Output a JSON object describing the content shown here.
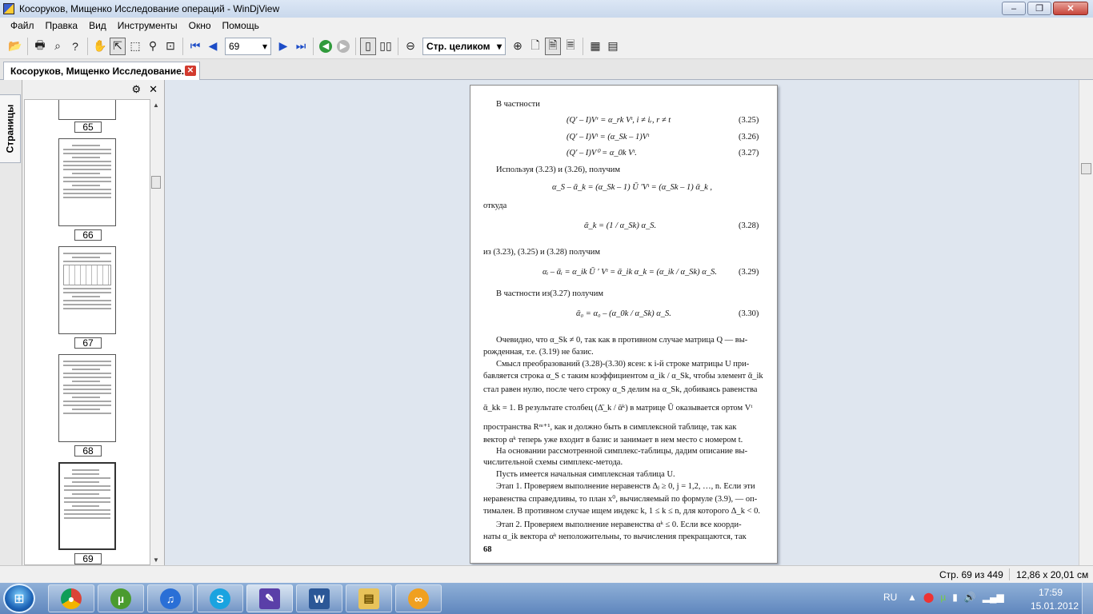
{
  "window": {
    "title": "Косоруков, Мищенко Исследование операций - WinDjView",
    "controls": {
      "minimize": "‒",
      "maximize": "❐",
      "close": "✕"
    }
  },
  "menu": [
    "Файл",
    "Правка",
    "Вид",
    "Инструменты",
    "Окно",
    "Помощь"
  ],
  "toolbar": {
    "page_number": "69",
    "zoom_mode": "Стр. целиком"
  },
  "tab": {
    "label": "Косоруков, Мищенко Исследование...",
    "close": "✕"
  },
  "sidebar": {
    "tab_label": "Страницы",
    "thumbnails": [
      {
        "page": "65"
      },
      {
        "page": "66"
      },
      {
        "page": "67"
      },
      {
        "page": "68"
      },
      {
        "page": "69"
      }
    ]
  },
  "document": {
    "lines": [
      {
        "text": "В частности",
        "style": "text"
      },
      {
        "text": "(Q′ – I)Vʳ = α_rk Vᵗ, i ≠ iᵣ, r ≠ t",
        "num": "(3.25)",
        "style": "eq"
      },
      {
        "text": "(Q′ – I)Vᵗ = (α_Sk – 1)Vᵗ",
        "num": "(3.26)",
        "style": "eq"
      },
      {
        "text": "(Q′ – I)V⁰ = α_0k Vᵗ.",
        "num": "(3.27)",
        "style": "eq"
      },
      {
        "text": "Используя (3.23) и (3.26), получим",
        "style": "text"
      },
      {
        "text": "α_S – ᾱ_k = (α_Sk – 1) Ū ′Vᵗ = (α_Sk – 1) ᾱ_k ,",
        "style": "eq"
      },
      {
        "text": "откуда",
        "style": "text"
      },
      {
        "text": "ᾱ_k = (1 / α_Sk) α_S.",
        "num": "(3.28)",
        "style": "eq"
      },
      {
        "text": "из (3.23), (3.25) и (3.28) получим",
        "style": "text"
      },
      {
        "text": "αᵢ – ᾱᵢ = α_ik Ū ′ Vᵗ = ᾱ_ik α_k = (α_ik / α_Sk) α_S.",
        "num": "(3.29)",
        "style": "eq"
      },
      {
        "text": "В частности из(3.27) получим",
        "style": "text"
      },
      {
        "text": "ᾱ₀ = α₀ – (α_0k / α_Sk) α_S.",
        "num": "(3.30)",
        "style": "eq"
      },
      {
        "text": "Очевидно, что α_Sk ≠ 0, так как в противном случае матрица Q — вы-",
        "style": "para"
      },
      {
        "text": "рожденная, т.е. (3.19) не базис.",
        "style": "text0"
      },
      {
        "text": "Смысл преобразований (3.28)-(3.30) ясен: к i-й строке матрицы U при-",
        "style": "para"
      },
      {
        "text": "бавляется строка α_S с таким коэффициентом α_ik / α_Sk, чтобы элемент ᾱ_ik",
        "style": "text0"
      },
      {
        "text": "стал равен нулю, после чего строку α_S делим на α_Sk, добиваясь равенства",
        "style": "text0"
      },
      {
        "text": "ᾱ_kk = 1. В результате столбец (Δ̄_k / ᾱᵏ) в матрице Ū оказывается ортом Vᵗ",
        "style": "text0"
      },
      {
        "text": "пространства Rᵐ⁺¹, как и должно быть в симплексной таблице, так как",
        "style": "text0"
      },
      {
        "text": "вектор αᵏ теперь уже входит в базис и занимает в нем место с номером t.",
        "style": "text0"
      },
      {
        "text": "На основании рассмотренной симплекс-таблицы, дадим описание вы-",
        "style": "para"
      },
      {
        "text": "числительной схемы симплекс-метода.",
        "style": "text0"
      },
      {
        "text": "Пусть имеется начальная симплексная таблица U.",
        "style": "para"
      },
      {
        "text": "Этап 1. Проверяем выполнение неравенств Δⱼ ≥ 0, j = 1,2, …, n. Если эти",
        "style": "para"
      },
      {
        "text": "неравенства справедливы, то план x⁰, вычисляемый по формуле (3.9), — оп-",
        "style": "text0"
      },
      {
        "text": "тимален. В противном случае ищем индекс k, 1 ≤ k ≤ n, для которого Δ_k < 0.",
        "style": "text0"
      },
      {
        "text": "Этап 2. Проверяем выполнение неравенства αᵏ ≤ 0. Если все коорди-",
        "style": "para"
      },
      {
        "text": "наты α_ik вектора αᵏ неположительны, то вычисления прекращаются, так",
        "style": "text0"
      },
      {
        "text": "68",
        "style": "pagenum"
      }
    ]
  },
  "status": {
    "page": "Стр. 69 из 449",
    "size": "12,86 x 20,01 см"
  },
  "taskbar": {
    "lang": "RU",
    "time": "17:59",
    "date": "15.01.2012"
  }
}
